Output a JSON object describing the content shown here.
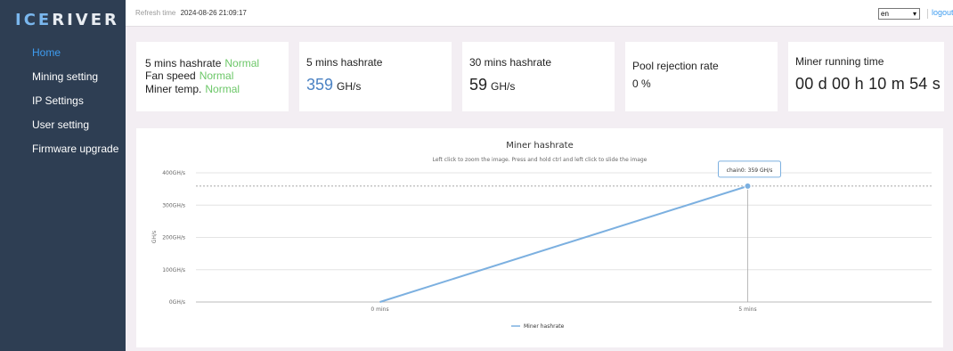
{
  "app": {
    "logo": "ICERIVER",
    "logo_ice": "ICE",
    "logo_river": "RIVER"
  },
  "sidebar": {
    "items": [
      {
        "label": "Home",
        "active": true
      },
      {
        "label": "Mining setting"
      },
      {
        "label": "IP Settings"
      },
      {
        "label": "User setting"
      },
      {
        "label": "Firmware upgrade"
      }
    ]
  },
  "topbar": {
    "refresh_label": "Refresh time",
    "refresh_value": "2024-08-26 21:09:17",
    "language": "en",
    "logout": "logout"
  },
  "status_card": {
    "hashrate_label": "5 mins hashrate",
    "hashrate_status": "Normal",
    "fan_label": "Fan speed",
    "fan_status": "Normal",
    "temp_label": "Miner temp.",
    "temp_status": "Normal",
    "status_color": "#6cc768"
  },
  "hash5": {
    "label": "5 mins hashrate",
    "value": "359",
    "unit": "GH/s"
  },
  "hash30": {
    "label": "30 mins hashrate",
    "value": "59",
    "unit": "GH/s"
  },
  "rejection": {
    "label": "Pool rejection rate",
    "value": "0 %"
  },
  "runtime": {
    "label": "Miner running time",
    "value": "00 d 00 h 10 m 54 s"
  },
  "chart_data": {
    "type": "line",
    "title": "Miner hashrate",
    "subtitle": "Left click to zoom the image. Press and hold ctrl and left click to slide the image",
    "ylabel": "GH/s",
    "categories": [
      "0 mins",
      "5 mins"
    ],
    "y_ticks": [
      {
        "label": "400GH/s",
        "value": 400
      },
      {
        "label": "300GH/s",
        "value": 300
      },
      {
        "label": "200GH/s",
        "value": 200
      },
      {
        "label": "100GH/s",
        "value": 100
      },
      {
        "label": "0GH/s",
        "value": 0
      }
    ],
    "ylim": [
      0,
      400
    ],
    "series": [
      {
        "name": "Miner hashrate",
        "values": [
          0,
          359
        ],
        "color": "#7cb0e0"
      }
    ],
    "tooltip": "chain0: 359 GH/s",
    "reference_line": 359,
    "legend_position": "bottom-center",
    "grid": true
  },
  "colors": {
    "sidebar_bg": "#2e3e53",
    "accent": "#3e9cf0",
    "normal": "#6cc768",
    "line": "#7cb0e0"
  }
}
